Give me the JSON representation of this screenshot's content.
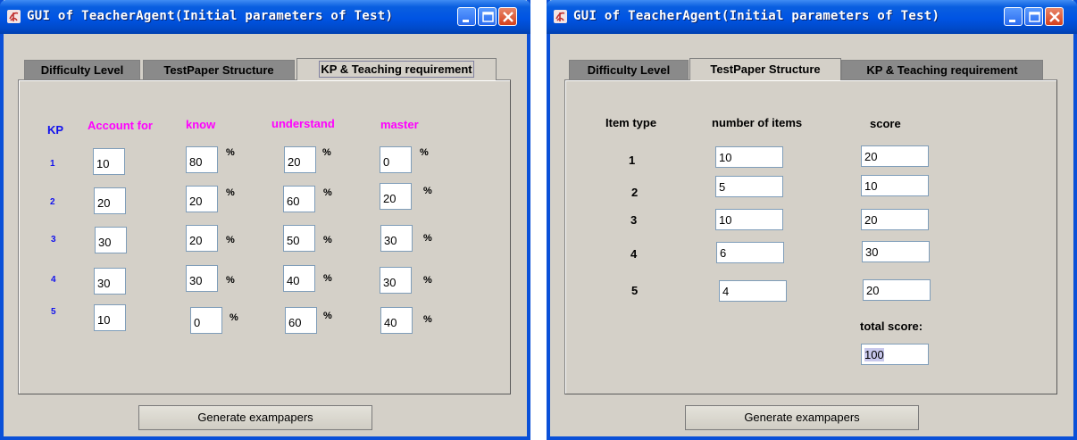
{
  "windows": [
    {
      "title": "GUI of TeacherAgent(Initial parameters of Test)",
      "tabs": [
        "Difficulty Level",
        "TestPaper Structure",
        "KP & Teaching requirement"
      ],
      "selected_tab": "KP & Teaching requirement",
      "headers": {
        "kp": "KP",
        "account": "Account for",
        "know": "know",
        "understand": "understand",
        "master": "master"
      },
      "percent_sign": "%",
      "rows": [
        {
          "kp": "1",
          "account": "10",
          "know": "80",
          "understand": "20",
          "master": "0"
        },
        {
          "kp": "2",
          "account": "20",
          "know": "20",
          "understand": "60",
          "master": "20"
        },
        {
          "kp": "3",
          "account": "30",
          "know": "20",
          "understand": "50",
          "master": "30"
        },
        {
          "kp": "4",
          "account": "30",
          "know": "30",
          "understand": "40",
          "master": "30"
        },
        {
          "kp": "5",
          "account": "10",
          "know": "0",
          "understand": "60",
          "master": "40"
        }
      ],
      "generate_label": "Generate exampapers"
    },
    {
      "title": "GUI of TeacherAgent(Initial parameters of Test)",
      "tabs": [
        "Difficulty Level",
        "TestPaper Structure",
        "KP & Teaching requirement"
      ],
      "selected_tab": "TestPaper Structure",
      "headers": {
        "item_type": "Item type",
        "number": "number of items",
        "score": "score"
      },
      "rows": [
        {
          "type": "1",
          "number": "10",
          "score": "20"
        },
        {
          "type": "2",
          "number": "5",
          "score": "10"
        },
        {
          "type": "3",
          "number": "10",
          "score": "20"
        },
        {
          "type": "4",
          "number": "6",
          "score": "30"
        },
        {
          "type": "5",
          "number": "4",
          "score": "20"
        }
      ],
      "total_label": "total score:",
      "total_value": "100",
      "generate_label": "Generate exampapers"
    }
  ]
}
